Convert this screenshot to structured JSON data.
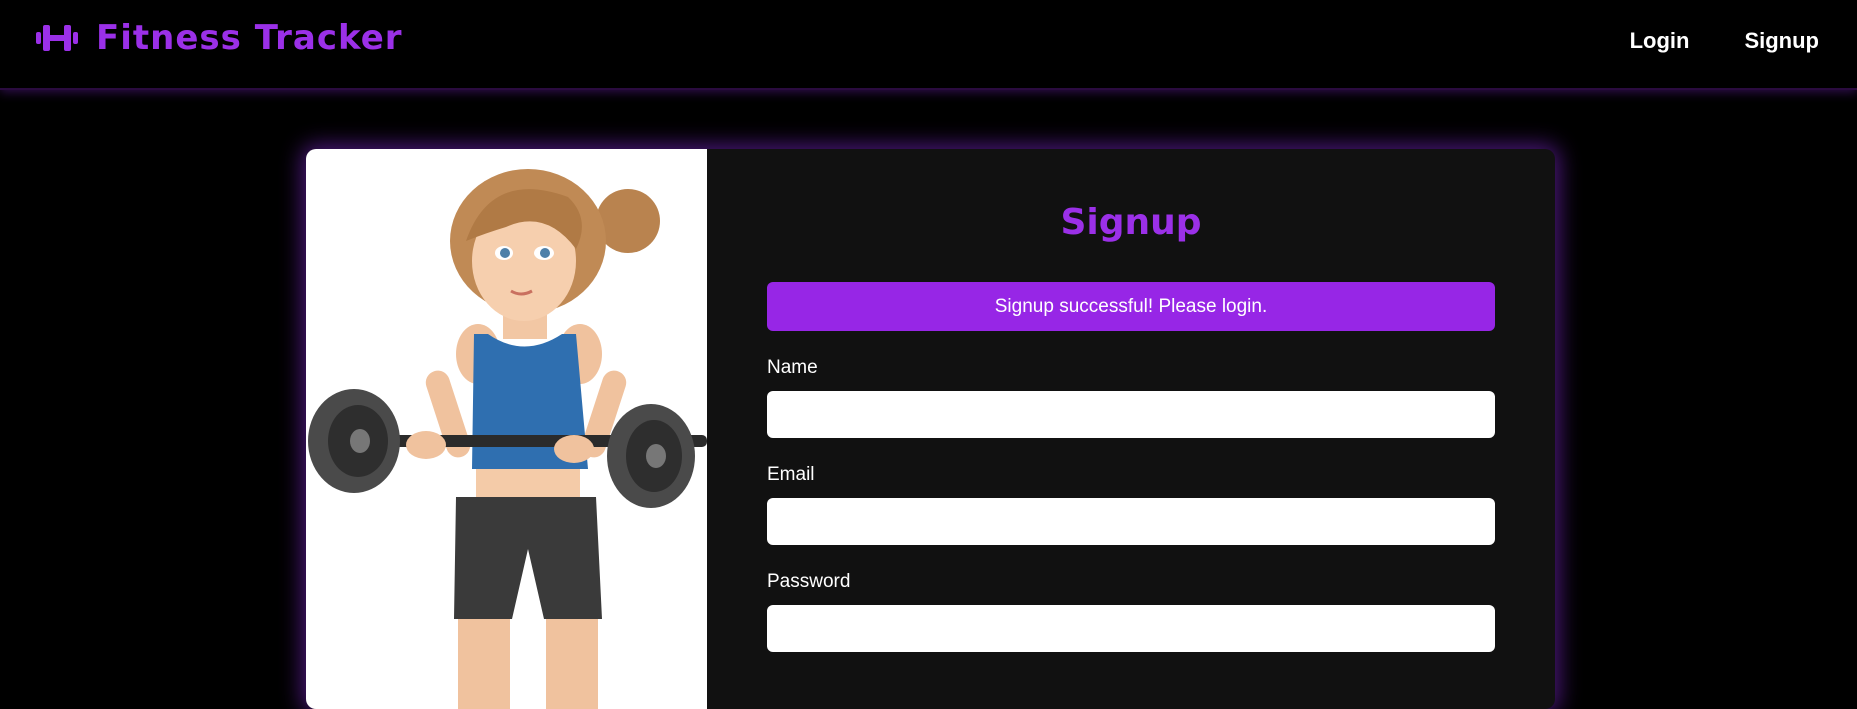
{
  "navbar": {
    "brand_icon": "dumbbell-icon",
    "brand_title": "Fitness Tracker",
    "links": [
      {
        "label": "Login"
      },
      {
        "label": "Signup"
      }
    ]
  },
  "illustration": {
    "subject": "woman-lifting-barbell-illustration"
  },
  "form": {
    "title": "Signup",
    "alert_message": "Signup successful! Please login.",
    "fields": [
      {
        "label": "Name",
        "value": "",
        "placeholder": ""
      },
      {
        "label": "Email",
        "value": "",
        "placeholder": ""
      },
      {
        "label": "Password",
        "value": "",
        "placeholder": ""
      }
    ]
  },
  "colors": {
    "accent": "#9b30e8",
    "alert_bg": "#9726e6",
    "page_bg": "#000000",
    "card_bg": "#111111"
  }
}
